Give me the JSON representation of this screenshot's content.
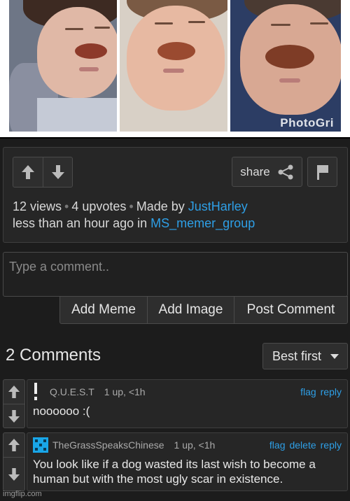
{
  "image": {
    "watermark": "PhotoGri"
  },
  "post": {
    "views": "12 views",
    "upvotes": "4 upvotes",
    "made_by_prefix": "Made by",
    "author": "JustHarley",
    "time_prefix": "less than an hour ago in",
    "stream": "MS_memer_group",
    "share_label": "share"
  },
  "comment_form": {
    "placeholder": "Type a comment..",
    "add_meme": "Add Meme",
    "add_image": "Add Image",
    "post_comment": "Post Comment"
  },
  "comments_section": {
    "title": "2 Comments",
    "sort": "Best first"
  },
  "comments": [
    {
      "author": "Q.U.E.S.T",
      "stats": "1 up, <1h",
      "actions": [
        "flag",
        "reply"
      ],
      "text": "noooooo :("
    },
    {
      "author": "TheGrassSpeaksChinese",
      "stats": "1 up, <1h",
      "actions": [
        "flag",
        "delete",
        "reply"
      ],
      "text": "You look like if a dog wasted its last wish to become a human but with the most ugly scar in existence."
    }
  ],
  "footer": {
    "watermark": "imgflip.com"
  },
  "colors": {
    "link": "#2e9fe6",
    "background": "#1c1c1c",
    "panel": "#262626"
  }
}
